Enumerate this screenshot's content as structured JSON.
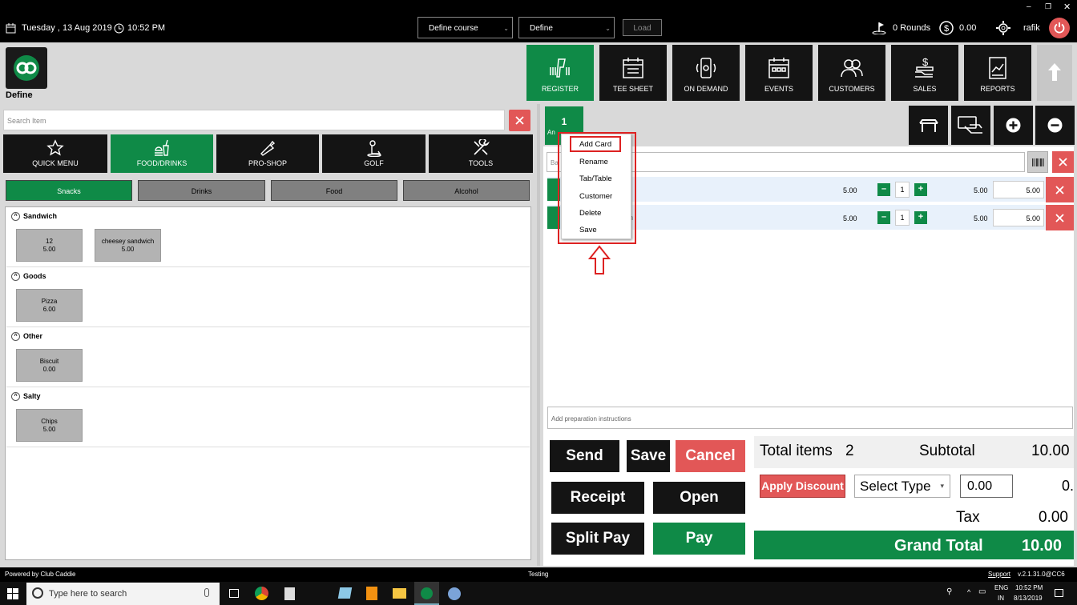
{
  "topbar": {
    "date": "Tuesday , 13 Aug 2019",
    "time": "10:52 PM",
    "course_select": "Define course",
    "define_select": "Define",
    "load_button": "Load",
    "rounds": "0 Rounds",
    "balance": "0.00",
    "user": "rafik"
  },
  "brand": {
    "name": "Define"
  },
  "nav": [
    {
      "label": "REGISTER",
      "icon": "barcode-scanner-icon"
    },
    {
      "label": "TEE SHEET",
      "icon": "calendar-icon"
    },
    {
      "label": "ON DEMAND",
      "icon": "phone-icon"
    },
    {
      "label": "EVENTS",
      "icon": "events-calendar-icon"
    },
    {
      "label": "CUSTOMERS",
      "icon": "users-icon"
    },
    {
      "label": "SALES",
      "icon": "sales-icon"
    },
    {
      "label": "REPORTS",
      "icon": "reports-icon"
    }
  ],
  "search": {
    "placeholder": "Search Item"
  },
  "categories": [
    {
      "label": "QUICK MENU"
    },
    {
      "label": "FOOD/DRINKS"
    },
    {
      "label": "PRO-SHOP"
    },
    {
      "label": "GOLF"
    },
    {
      "label": "TOOLS"
    }
  ],
  "subcategories": [
    "Snacks",
    "Drinks",
    "Food",
    "Alcohol"
  ],
  "groups": [
    {
      "name": "Sandwich",
      "items": [
        {
          "name": "12",
          "price": "5.00"
        },
        {
          "name": "cheesey sandwich",
          "price": "5.00"
        }
      ]
    },
    {
      "name": "Goods",
      "items": [
        {
          "name": "Pizza",
          "price": "6.00"
        }
      ]
    },
    {
      "name": "Other",
      "items": [
        {
          "name": "Biscuit",
          "price": "0.00"
        }
      ]
    },
    {
      "name": "Salty",
      "items": [
        {
          "name": "Chips",
          "price": "5.00"
        }
      ]
    }
  ],
  "tab": {
    "number": "1",
    "label": "An"
  },
  "barcode": {
    "placeholder": "Ba"
  },
  "lines": [
    {
      "name": "",
      "price": "5.00",
      "qty": "1",
      "total": "5.00",
      "edit": "5.00"
    },
    {
      "name": "h",
      "price": "5.00",
      "qty": "1",
      "total": "5.00",
      "edit": "5.00"
    }
  ],
  "context_menu": [
    "Add Card",
    "Rename",
    "Tab/Table",
    "Customer",
    "Delete",
    "Save"
  ],
  "instructions": {
    "placeholder": "Add preparation instructions"
  },
  "actions": {
    "send": "Send",
    "save": "Save",
    "cancel": "Cancel",
    "receipt": "Receipt",
    "open": "Open",
    "split": "Split Pay",
    "pay": "Pay"
  },
  "totals": {
    "items_label": "Total items",
    "items": "2",
    "subtotal_label": "Subtotal",
    "subtotal": "10.00",
    "discount_button": "Apply Discount",
    "select_type": "Select Type",
    "discount_value": "0.00",
    "discount_amount": "0.",
    "tax_label": "Tax",
    "tax": "0.00",
    "grand_label": "Grand Total",
    "grand": "10.00"
  },
  "status": {
    "powered": "Powered by Club Caddie",
    "env": "Testing",
    "support": "Support",
    "version": "v.2.1.31.0@CC6"
  },
  "taskbar": {
    "search": "Type here to search",
    "lang": "ENG",
    "region": "IN",
    "time": "10:52 PM",
    "date": "8/13/2019"
  },
  "colors": {
    "green": "#0f8a47",
    "red": "#e25757",
    "dark": "#141414"
  }
}
